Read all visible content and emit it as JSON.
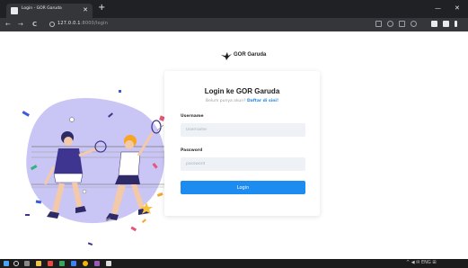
{
  "browser": {
    "tab_title": "Login - GOR Garuda",
    "tab_close": "✕",
    "new_tab": "+",
    "url_host": "127.0.0.1",
    "url_rest": ":8000/login",
    "minimize": "—",
    "close": "✕",
    "back": "←",
    "forward": "→",
    "reload": "C"
  },
  "page": {
    "logo_text": "GOR Garuda",
    "title": "Login ke GOR Garuda",
    "subtitle_prefix": "Belum punya akun? ",
    "subtitle_link": "Daftar di sini!",
    "username_label": "Username",
    "username_placeholder": "Username",
    "password_label": "Password",
    "password_placeholder": "password",
    "login_button": "Login"
  },
  "taskbar": {
    "tray_text": "^  ◀  ✉  ENG  ⊞"
  },
  "colors": {
    "accent": "#1d8cf0",
    "illustration_blob": "#c9c5f5",
    "illustration_dark": "#2e2a67"
  }
}
